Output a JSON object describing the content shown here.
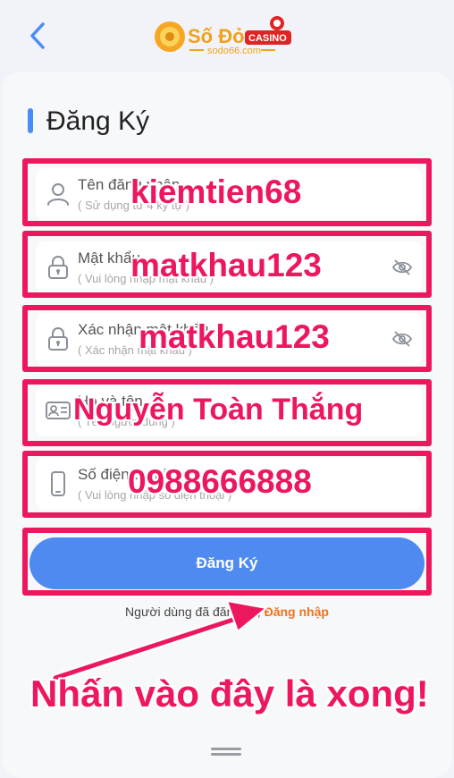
{
  "header": {
    "logo_main": "Số Đỏ",
    "logo_badge": "CASINO",
    "logo_sub": "sodo66.com"
  },
  "form": {
    "title": "Đăng Ký",
    "fields": [
      {
        "label": "Tên đăng nhập",
        "placeholder": "( Sử dụng từ 4 ký tự )",
        "value": "kiemtien68",
        "icon": "user-icon"
      },
      {
        "label": "Mật khẩu",
        "placeholder": "( Vui lòng nhập mật khẩu )",
        "value": "matkhau123",
        "icon": "lock-icon"
      },
      {
        "label": "Xác nhận mật khẩu",
        "placeholder": "( Xác nhận mật khẩu )",
        "value": "matkhau123",
        "icon": "lock-icon"
      },
      {
        "label": "Họ và tên",
        "placeholder": "( Tên người dùng )",
        "value": "Nguyễn Toàn Thắng",
        "icon": "id-card-icon"
      },
      {
        "label": "Số điện thoại",
        "placeholder": "( Vui lòng nhập số điện thoại )",
        "value": "0988666888",
        "icon": "phone-icon"
      }
    ],
    "submit_label": "Đăng Ký",
    "login_prompt": "Người dùng đã đăng kí ,",
    "login_link": "Đăng nhập"
  },
  "annotation": {
    "caption": "Nhấn vào đây là xong!"
  },
  "colors": {
    "accent": "#4f8af0",
    "highlight": "#ed175d",
    "link": "#f0731e"
  }
}
